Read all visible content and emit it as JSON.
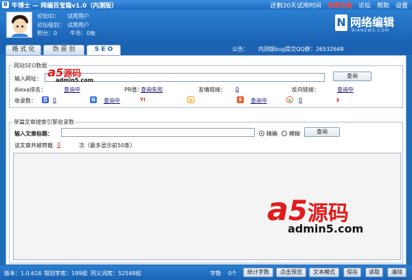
{
  "window": {
    "title": "牛博士 — 网编百宝箱v1.0（内测版）"
  },
  "menu": {
    "trial": "还剩30天试用时间",
    "register": "免费注册",
    "forum": "论坛",
    "help": "帮助",
    "settings": "设置"
  },
  "user": {
    "forum_id_label": "论坛ID：",
    "forum_id_value": "试用用户",
    "forum_level_label": "论坛级别：",
    "forum_level_value": "试用用户",
    "points_label": "积分：",
    "points_value": "0",
    "coins_label": "牛币：",
    "coins_value": "0枚"
  },
  "brand": {
    "name": "网络编辑",
    "url": "BIANEWS.COM"
  },
  "tabs": [
    {
      "label": "格 式 化"
    },
    {
      "label": "伪 原 创"
    },
    {
      "label": "S E O"
    }
  ],
  "announcement": {
    "label": "公告：",
    "text": "内测版bug提交QQ群：26532648"
  },
  "seo": {
    "legend": "网站SEO数据",
    "url_label": "输入网址：",
    "url_value": "",
    "query_button": "查询",
    "alexa_label": "Alexa排名：",
    "alexa_value": "查询中",
    "pr_label": "PR值：",
    "pr_value": "查询失败",
    "friend_links_label": "友情链接：",
    "friend_links_value": "0",
    "backlinks_label": "反向链接：",
    "backlinks_value": "查询中",
    "indexed_label": "收录数：",
    "engines": [
      {
        "icon": "baidu-icon",
        "value": "0",
        "color": "#2d5bd6"
      },
      {
        "icon": "google-icon",
        "value": "查询中",
        "color": "#3a7be0"
      },
      {
        "icon": "yahoo-icon",
        "value": "",
        "color": "#d21f1f"
      },
      {
        "icon": "bing-icon",
        "value": "",
        "color": "#f4a20a"
      },
      {
        "icon": "sogou-icon",
        "value": "查询中",
        "color": "#e8572a"
      },
      {
        "icon": "soso-icon",
        "value": "0",
        "color": "#2a9d3e"
      },
      {
        "icon": "youdao-icon",
        "value": "",
        "color": "#d21f1f"
      }
    ]
  },
  "article": {
    "legend": "单篇文章搜索引擎收录数",
    "title_label": "输入文章标题：",
    "title_value": "",
    "option_exact": "精确",
    "option_fuzzy": "模糊",
    "query_button": "查询",
    "reprint_prefix": "该文章共被转载",
    "reprint_count": "0",
    "reprint_suffix": "次（最多显示前50条）"
  },
  "watermark": {
    "brand_a": "a",
    "brand_5": "5",
    "brand_cn": "源码",
    "domain": "admin5.com"
  },
  "status": {
    "version": "版本：1.0.616",
    "typo_db": "错别字库：199组",
    "synonym_db": "同义词库：52548组",
    "char_count_label": "字数",
    "char_count_value": "0个",
    "buttons": {
      "count": "统计字数",
      "preview": "点击预览",
      "text_mode": "文本模式",
      "save": "保存",
      "read": "读取",
      "clear": "清除"
    }
  },
  "colors": {
    "frame": "#1f6fb8",
    "accent_red": "#d21f1f",
    "link": "#1a1a7a"
  }
}
